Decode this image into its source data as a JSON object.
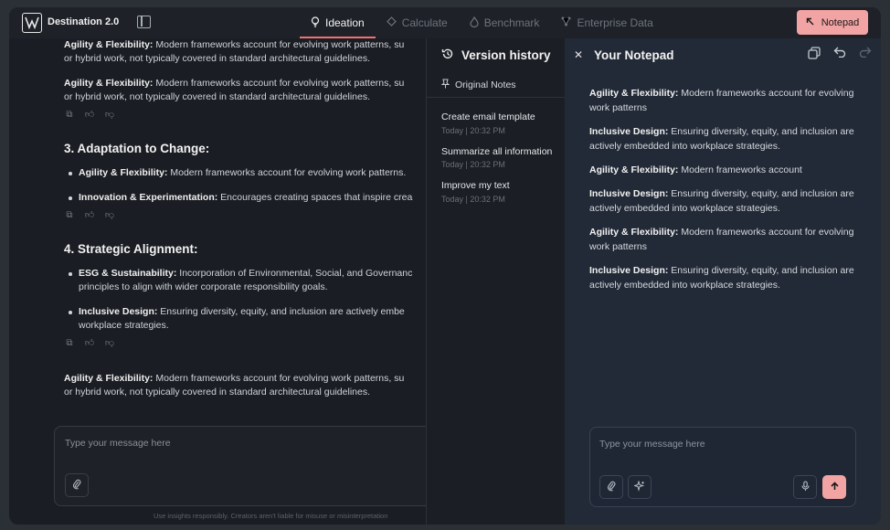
{
  "app": {
    "brand": "Destination 2.0"
  },
  "nav": {
    "tabs": [
      {
        "label": "Ideation",
        "icon": "lightbulb-icon",
        "active": true
      },
      {
        "label": "Calculate",
        "icon": "diamond-icon",
        "active": false
      },
      {
        "label": "Benchmark",
        "icon": "flame-icon",
        "active": false
      },
      {
        "label": "Enterprise Data",
        "icon": "nodes-icon",
        "active": false
      }
    ],
    "notepad_button": "Notepad"
  },
  "chat": {
    "lines": [
      {
        "bold": "Agility & Flexibility:",
        "text": " Modern frameworks account for evolving work patterns, su"
      },
      {
        "bold": "",
        "text": "or hybrid work, not typically covered in standard architectural guidelines."
      },
      {
        "bold": "Agility & Flexibility:",
        "text": " Modern frameworks account for evolving work patterns, su"
      },
      {
        "bold": "",
        "text": "or hybrid work, not typically covered in standard architectural guidelines."
      }
    ],
    "section3": {
      "heading": "3. Adaptation to Change:",
      "bullets": [
        {
          "bold": "Agility & Flexibility:",
          "text": " Modern frameworks account for evolving work patterns."
        },
        {
          "bold": "Innovation & Experimentation:",
          "text": " Encourages creating spaces that inspire crea"
        }
      ]
    },
    "section4": {
      "heading": "4. Strategic Alignment:",
      "bullets": [
        {
          "bold": "ESG & Sustainability:",
          "text": " Incorporation of Environmental, Social, and Governanc",
          "line2": "principles to align with wider corporate responsibility goals."
        },
        {
          "bold": "Inclusive Design:",
          "text": " Ensuring diversity, equity, and inclusion are actively embe",
          "line2": "workplace strategies."
        }
      ]
    },
    "final": {
      "bold": "Agility & Flexibility:",
      "text": " Modern frameworks account for evolving work patterns, su",
      "line2": "or hybrid work, not typically covered in standard architectural guidelines."
    },
    "composer_placeholder": "Type your message here",
    "disclaimer": "Use insights responsibly. Creators aren't liable for misuse or misinterpretation"
  },
  "version_history": {
    "title": "Version history",
    "original": "Original Notes",
    "items": [
      {
        "title": "Create email template",
        "time": "Today | 20:32 PM"
      },
      {
        "title": "Summarize all information",
        "time": "Today | 20:32 PM"
      },
      {
        "title": "Improve my text",
        "time": "Today | 20:32 PM"
      }
    ]
  },
  "notepad": {
    "title": "Your Notepad",
    "notes": [
      {
        "bold": "Agility & Flexibility:",
        "text": " Modern frameworks account for evolving work patterns"
      },
      {
        "bold": "Inclusive Design:",
        "text": " Ensuring diversity, equity, and inclusion are actively embedded into workplace strategies."
      },
      {
        "bold": "Agility & Flexibility:",
        "text": " Modern frameworks account"
      },
      {
        "bold": "Inclusive Design:",
        "text": " Ensuring diversity, equity, and inclusion are actively embedded into workplace strategies."
      },
      {
        "bold": "Agility & Flexibility:",
        "text": " Modern frameworks account for evolving work patterns"
      },
      {
        "bold": "Inclusive Design:",
        "text": " Ensuring diversity, equity, and inclusion are actively embedded into workplace strategies."
      }
    ],
    "composer_placeholder": "Type your message here"
  },
  "colors": {
    "accent": "#f2a3a3",
    "tab_underline": "#ef7272"
  }
}
